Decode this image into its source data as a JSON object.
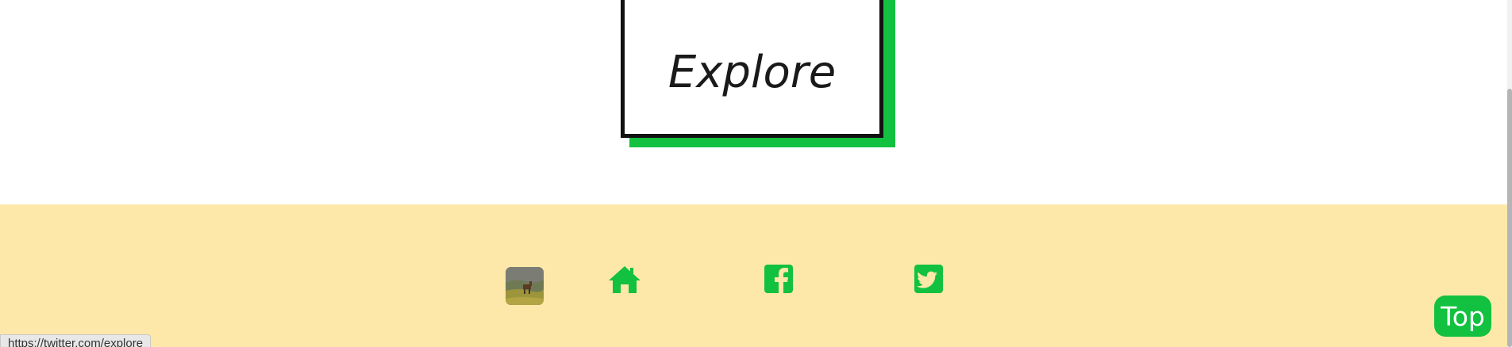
{
  "hero": {
    "explore_label": "Explore"
  },
  "footer": {
    "avatar_icon": "horse-landscape-image",
    "links": [
      {
        "name": "home",
        "icon": "home-icon"
      },
      {
        "name": "facebook",
        "icon": "facebook-icon"
      },
      {
        "name": "twitter",
        "icon": "twitter-icon"
      }
    ],
    "top_label": "Top"
  },
  "status": {
    "url": "https://twitter.com/explore"
  },
  "colors": {
    "accent_green": "#12c13f",
    "footer_bg": "#fde8a9",
    "border_dark": "#111111"
  }
}
